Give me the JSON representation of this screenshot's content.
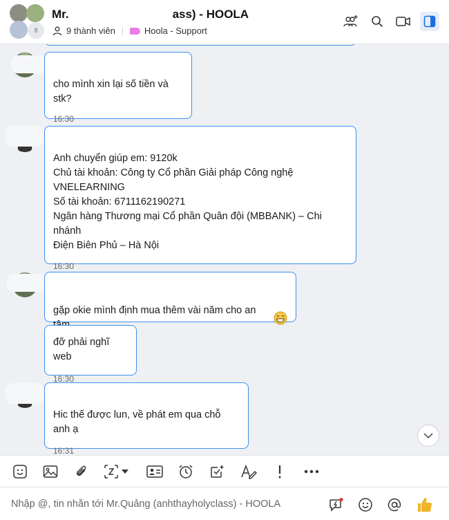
{
  "header": {
    "title_start": "Mr.",
    "title_end": "ass) - HOOLA",
    "member_count": "9 thành viên",
    "tag_label": "Hoola - Support",
    "avatar_more": "8"
  },
  "messages": [
    {
      "text": "cho mình xin lại số tiền và stk?",
      "time": "16:30"
    },
    {
      "text": "Anh chuyển giúp em: 9120k\nChủ tài khoản: Công ty Cổ phần Giải pháp Công nghệ\nVNELEARNING\nSố tài khoản: 6711162190271\nNgân hàng Thương mại Cổ phần Quân đội (MBBANK) – Chi nhánh\nĐiện Biên Phủ – Hà Nội",
      "time": "16:30"
    },
    {
      "text": "gặp okie mình định mua thêm vài năm cho an tâm",
      "emoji": "😁"
    },
    {
      "text": "đỡ phải nghĩ web",
      "time": "16:30"
    },
    {
      "text": "Hic thế được lun, về phát em qua chỗ anh ạ",
      "time": "16:31"
    }
  ],
  "composer": {
    "placeholder": "Nhập @, tin nhắn tới Mr.Quảng (anhthayholyclass) - HOOLA"
  },
  "colors": {
    "accent": "#3b8ef0",
    "like": "#f0b429"
  }
}
